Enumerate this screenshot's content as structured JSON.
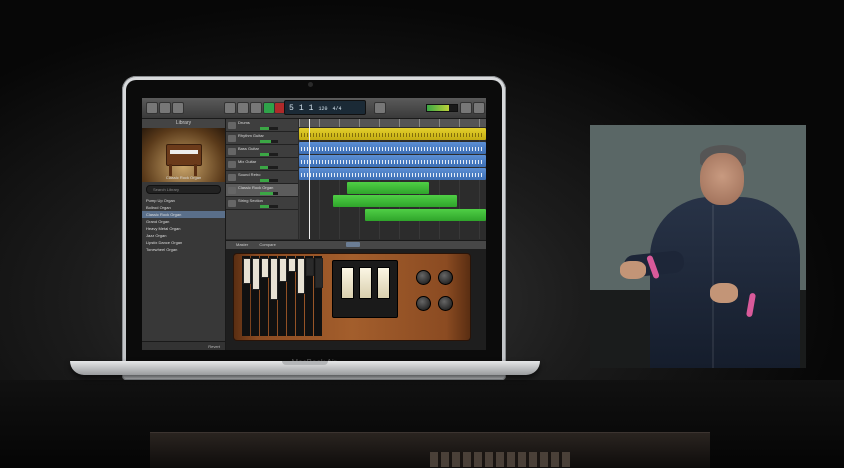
{
  "scene": {
    "description_icons": [
      "laptop-icon",
      "person-icon"
    ]
  },
  "laptop": {
    "brand_label": "MacBook Air"
  },
  "app": {
    "lcd": {
      "bar": "5",
      "beat": "1",
      "sub": "1",
      "tempo": "120",
      "time_sig": "4/4"
    },
    "library": {
      "title": "Library",
      "instrument_caption": "Classic Rock Organ",
      "search_placeholder": "Search Library",
      "items": [
        {
          "label": "Pump Up Organ",
          "selected": false
        },
        {
          "label": "Bollrod Organ",
          "selected": false
        },
        {
          "label": "Classic Rock Organ",
          "selected": true
        },
        {
          "label": "Grand Organ",
          "selected": false
        },
        {
          "label": "Heavy Metal Organ",
          "selected": false
        },
        {
          "label": "Jazz Organ",
          "selected": false
        },
        {
          "label": "Lipstix Dance Organ",
          "selected": false
        },
        {
          "label": "Tonewheel Organ",
          "selected": false
        }
      ],
      "footer_button": "Revert"
    },
    "tracks": [
      {
        "name": "Drums",
        "volume": 0.5
      },
      {
        "name": "Rhythm Guitar",
        "volume": 0.6
      },
      {
        "name": "Bass Guitar",
        "volume": 0.5
      },
      {
        "name": "Mix Guitar",
        "volume": 0.45
      },
      {
        "name": "Sound Retro",
        "volume": 0.5
      },
      {
        "name": "Classic Rock Organ",
        "volume": 0.7,
        "selected": true
      },
      {
        "name": "String Section",
        "volume": 0.5
      }
    ],
    "editor": {
      "tabs": [
        "Master",
        "Compare"
      ],
      "mode_label": "Controls",
      "control_labels": [
        "PERCUSSION",
        "VIBRATO",
        "DECAY",
        "LEVEL",
        "VOLUME",
        "DRIVE"
      ]
    },
    "colors": {
      "drums_region": "#e3cf2c",
      "audio_region": "#5c8fd4",
      "midi_region": "#4fcf45"
    }
  }
}
